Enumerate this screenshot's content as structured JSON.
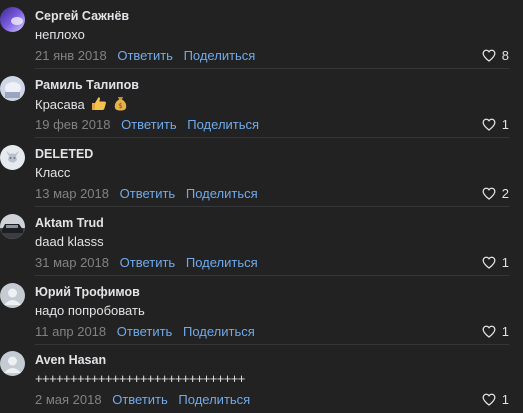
{
  "comments": [
    {
      "author": "Сергей Сажнёв",
      "text": "неплохо",
      "date": "21 янв 2018",
      "reply": "Ответить",
      "share": "Поделиться",
      "likes": "8",
      "avatar": "purple-light-avatar"
    },
    {
      "author": "Рамиль Талипов",
      "text": "Красава",
      "emoji": [
        "thumbs-up-icon",
        "money-bag-icon"
      ],
      "date": "19 фев 2018",
      "reply": "Ответить",
      "share": "Поделиться",
      "likes": "1",
      "avatar": "light-photo-avatar"
    },
    {
      "author": "DELETED",
      "text": "Класс",
      "date": "13 мар 2018",
      "reply": "Ответить",
      "share": "Поделиться",
      "likes": "2",
      "avatar": "deleted-dog-avatar"
    },
    {
      "author": "Aktam Trud",
      "text": "daad klasss",
      "date": "31 мар 2018",
      "reply": "Ответить",
      "share": "Поделиться",
      "likes": "1",
      "avatar": "car-photo-avatar"
    },
    {
      "author": "Юрий Трофимов",
      "text": "надо попробовать",
      "date": "11 апр 2018",
      "reply": "Ответить",
      "share": "Поделиться",
      "likes": "1",
      "avatar": "default-user-avatar"
    },
    {
      "author": "Aven Hasan",
      "text": "++++++++++++++++++++++++++++++",
      "date": "2 мая 2018",
      "reply": "Ответить",
      "share": "Поделиться",
      "likes": "1",
      "avatar": "default-user-avatar"
    }
  ],
  "colors": {
    "background": "#222222",
    "link": "#71aaeb",
    "date": "#828282",
    "text": "#e1e3e6"
  },
  "icons": {
    "like": "heart-outline-icon"
  }
}
